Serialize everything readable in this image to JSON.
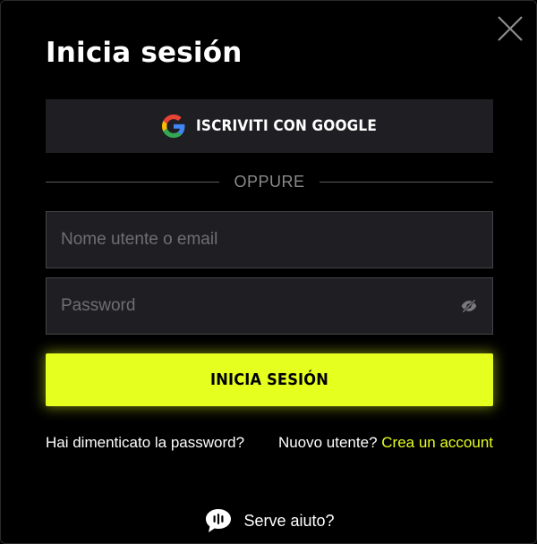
{
  "modal": {
    "title": "Inicia sesión"
  },
  "google_button": {
    "label": "ISCRIVITI CON GOOGLE",
    "icon": "google-g-icon"
  },
  "divider": {
    "text": "OPPURE"
  },
  "username_field": {
    "value": "",
    "placeholder": "Nome utente o email"
  },
  "password_field": {
    "value": "",
    "placeholder": "Password",
    "toggle_icon": "eye-slash-icon"
  },
  "submit_button": {
    "label": "INICIA SESIÓN"
  },
  "links": {
    "forgot_password": "Hai dimenticato la password?",
    "new_user_prompt": "Nuovo utente?",
    "create_account": "Crea un account"
  },
  "help": {
    "label": "Serve aiuto?",
    "icon": "chat-bubble-icon"
  },
  "colors": {
    "background": "#000000",
    "field_bg": "#1f1f23",
    "accent": "#e5ff1f",
    "muted_text": "#8a8a8a"
  }
}
